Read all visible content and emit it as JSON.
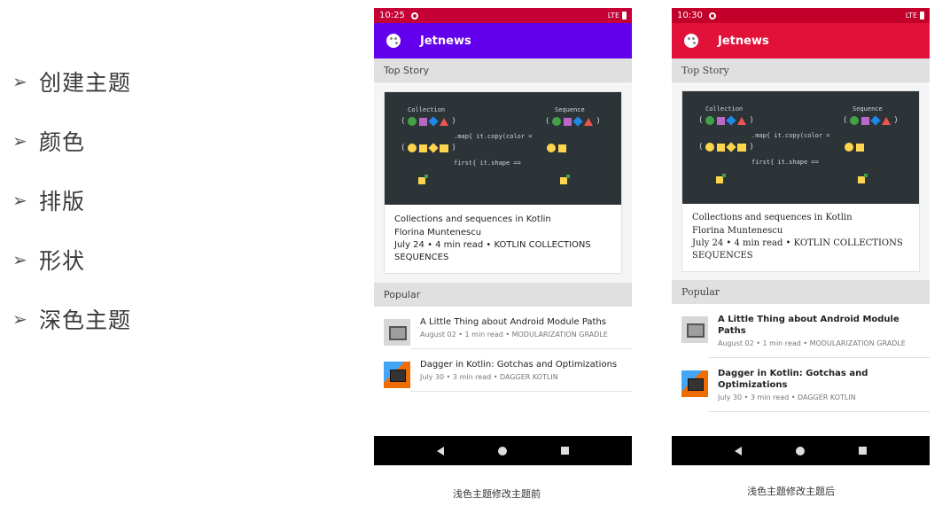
{
  "bullets": [
    {
      "mark": "➢",
      "text": "创建主题"
    },
    {
      "mark": "➢",
      "text": "颜色"
    },
    {
      "mark": "➢",
      "text": "排版"
    },
    {
      "mark": "➢",
      "text": "形状"
    },
    {
      "mark": "➢",
      "text": "深色主题"
    }
  ],
  "phone_before": {
    "time": "10:25",
    "signal": "LTE",
    "app_title": "Jetnews",
    "top_story_header": "Top Story",
    "card_title": "Collections and sequences in Kotlin",
    "card_author": "Florina Muntenescu",
    "card_meta": "July 24 • 4 min read • KOTLIN COLLECTIONS SEQUENCES",
    "popular_header": "Popular",
    "popular": [
      {
        "title": "A Little Thing about Android Module Paths",
        "meta": "August 02 • 1 min read • MODULARIZATION GRADLE"
      },
      {
        "title": "Dagger in Kotlin: Gotchas and Optimizations",
        "meta": "July 30 • 3 min read • DAGGER KOTLIN"
      }
    ],
    "theme": {
      "status": "#c40034",
      "appbar": "#6200ee"
    }
  },
  "phone_after": {
    "time": "10:30",
    "signal": "LTE",
    "app_title": "Jetnews",
    "top_story_header": "Top Story",
    "card_title": "Collections and sequences in Kotlin",
    "card_author": "Florina Muntenescu",
    "card_meta": "July 24 • 4 min read • KOTLIN COLLECTIONS SEQUENCES",
    "popular_header": "Popular",
    "popular": [
      {
        "title": "A Little Thing about Android Module Paths",
        "meta": "August 02 • 1 min read • MODULARIZATION GRADLE"
      },
      {
        "title": "Dagger in Kotlin: Gotchas and Optimizations",
        "meta": "July 30 • 3 min read • DAGGER KOTLIN"
      }
    ],
    "theme": {
      "status": "#c20029",
      "appbar": "#e1113a"
    }
  },
  "illustration": {
    "label_collection": "Collection",
    "label_sequence": "Sequence",
    "code_map": ".map{ it.copy(color = ",
    "code_first": "first{ it.shape == "
  },
  "captions": {
    "before": "浅色主题修改主题前",
    "after": "浅色主题修改主题后"
  },
  "icons": [
    "palette-icon",
    "settings-gear-icon",
    "battery-icon",
    "back-icon",
    "home-icon",
    "recents-icon"
  ]
}
